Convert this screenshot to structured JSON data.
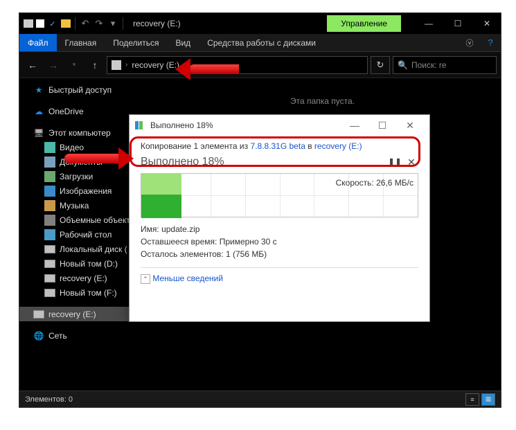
{
  "titlebar": {
    "title": "recovery (E:)",
    "manage": "Управление"
  },
  "ribbon": {
    "file": "Файл",
    "main": "Главная",
    "share": "Поделиться",
    "view": "Вид",
    "disks": "Средства работы с дисками"
  },
  "nav": {
    "path": "recovery (E:)",
    "refresh": "↻",
    "search": "Поиск: re"
  },
  "sidebar": {
    "quick": "Быстрый доступ",
    "onedrive": "OneDrive",
    "thispc": "Этот компьютер",
    "video": "Видео",
    "docs": "Документы",
    "downloads": "Загрузки",
    "images": "Изображения",
    "music": "Музыка",
    "objects": "Объемные объект",
    "desktop": "Рабочий стол",
    "localc": "Локальный диск (",
    "newd": "Новый том (D:)",
    "rece": "recovery (E:)",
    "newf": "Новый том (F:)",
    "rece2": "recovery (E:)",
    "net": "Сеть"
  },
  "content": {
    "empty": "Эта папка пуста."
  },
  "status": {
    "elements": "Элементов: 0"
  },
  "dialog": {
    "title": "Выполнено 18%",
    "copy_pre": "Копирование 1 элемента из ",
    "copy_src": "7.8.8.31G beta",
    "copy_mid": " в ",
    "copy_dst": "recovery (E:)",
    "status": "Выполнено 18%",
    "speed": "Скорость: 26,6 МБ/с",
    "name_l": "Имя:",
    "name_v": "update.zip",
    "time_l": "Оставшееся время:",
    "time_v": "Примерно 30 с",
    "remain_l": "Осталось элементов:",
    "remain_v": "1 (756 МБ)",
    "less": "Меньше сведений"
  }
}
